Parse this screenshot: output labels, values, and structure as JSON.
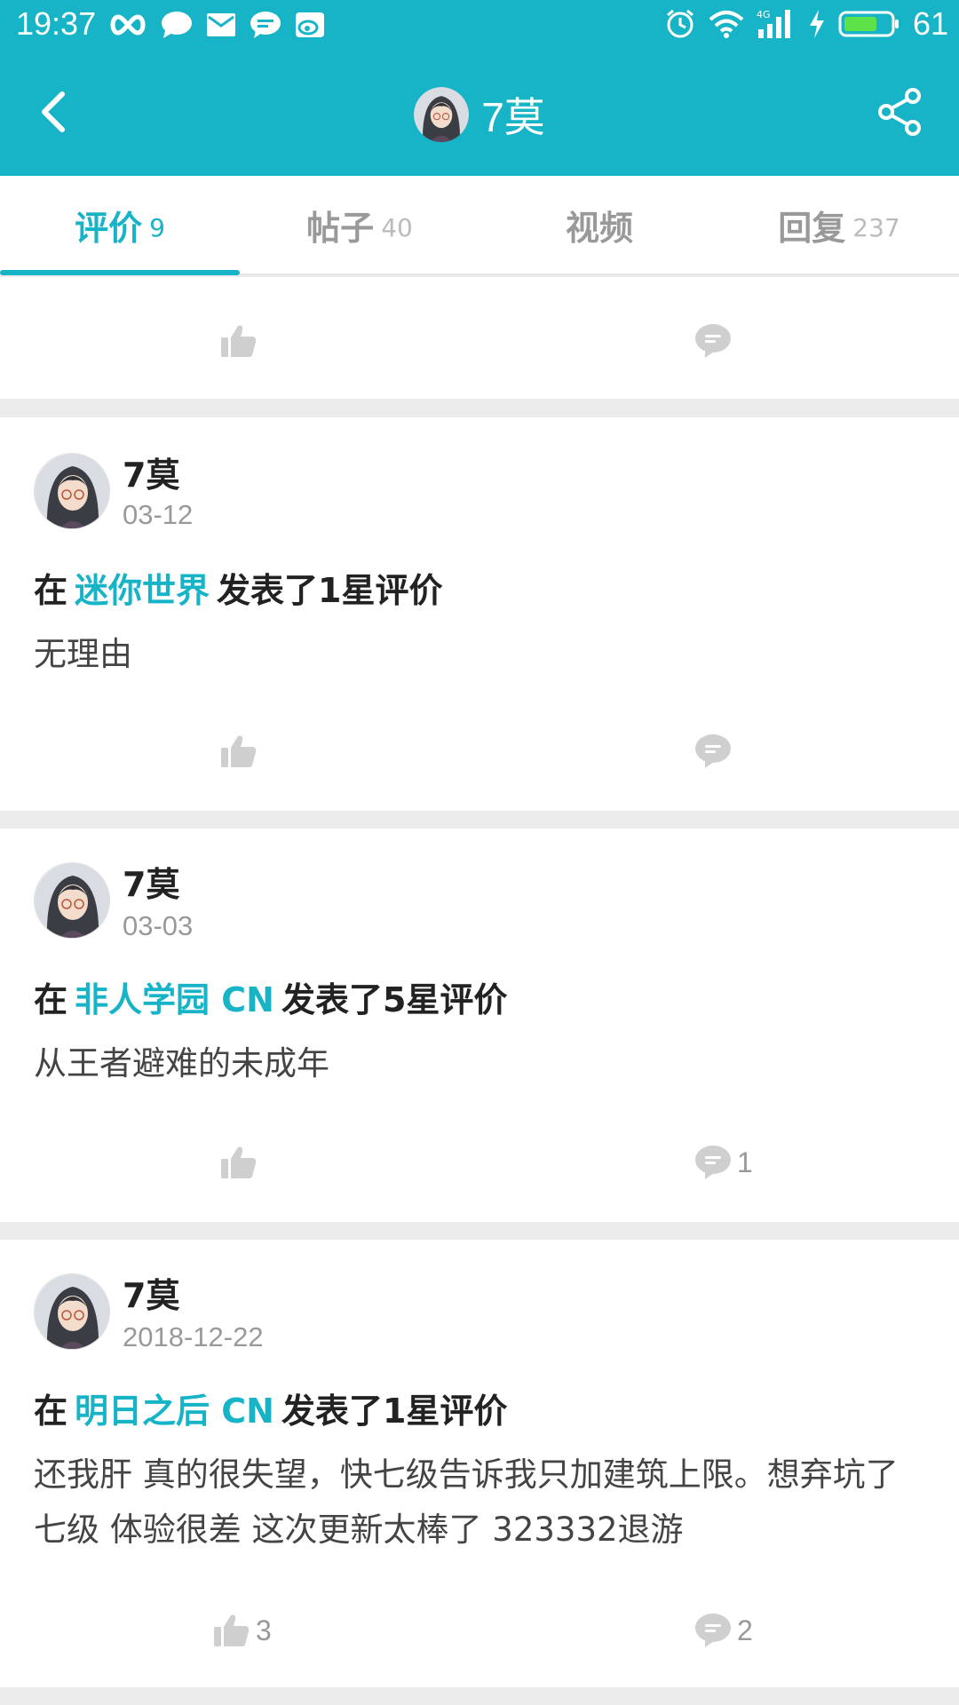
{
  "status_bar": {
    "time": "19:37",
    "battery_level": "61",
    "left_icons": [
      "infinity-icon",
      "chat-bubble-icon",
      "mail-icon",
      "message-icon",
      "weibo-icon"
    ],
    "right_icons": [
      "alarm-icon",
      "wifi-icon",
      "signal-4g-icon",
      "charging-icon",
      "battery-icon"
    ]
  },
  "header": {
    "title": "7莫",
    "back_icon": "chevron-left-icon",
    "share_icon": "share-icon",
    "background_color": "#16b4c6"
  },
  "tabs": [
    {
      "label": "评价",
      "count": "9",
      "active": true
    },
    {
      "label": "帖子",
      "count": "40",
      "active": false
    },
    {
      "label": "视频",
      "count": "",
      "active": false
    },
    {
      "label": "回复",
      "count": "237",
      "active": false
    }
  ],
  "reviews": [
    {
      "user": "7莫",
      "date": "03-12",
      "prefix": "在",
      "game": "迷你世界",
      "suffix": "发表了1星评价",
      "body": "无理由",
      "likes": "",
      "comments": ""
    },
    {
      "user": "7莫",
      "date": "03-03",
      "prefix": "在",
      "game": "非人学园 CN",
      "suffix": "发表了5星评价",
      "body": "从王者避难的未成年",
      "likes": "",
      "comments": "1"
    },
    {
      "user": "7莫",
      "date": "2018-12-22",
      "prefix": "在",
      "game": "明日之后 CN",
      "suffix": "发表了1星评价",
      "body": "还我肝 真的很失望，快七级告诉我只加建筑上限。想弃坑了 七级 体验很差 这次更新太棒了 323332退游",
      "likes": "3",
      "comments": "2"
    }
  ],
  "accent_color": "#16b4c6"
}
